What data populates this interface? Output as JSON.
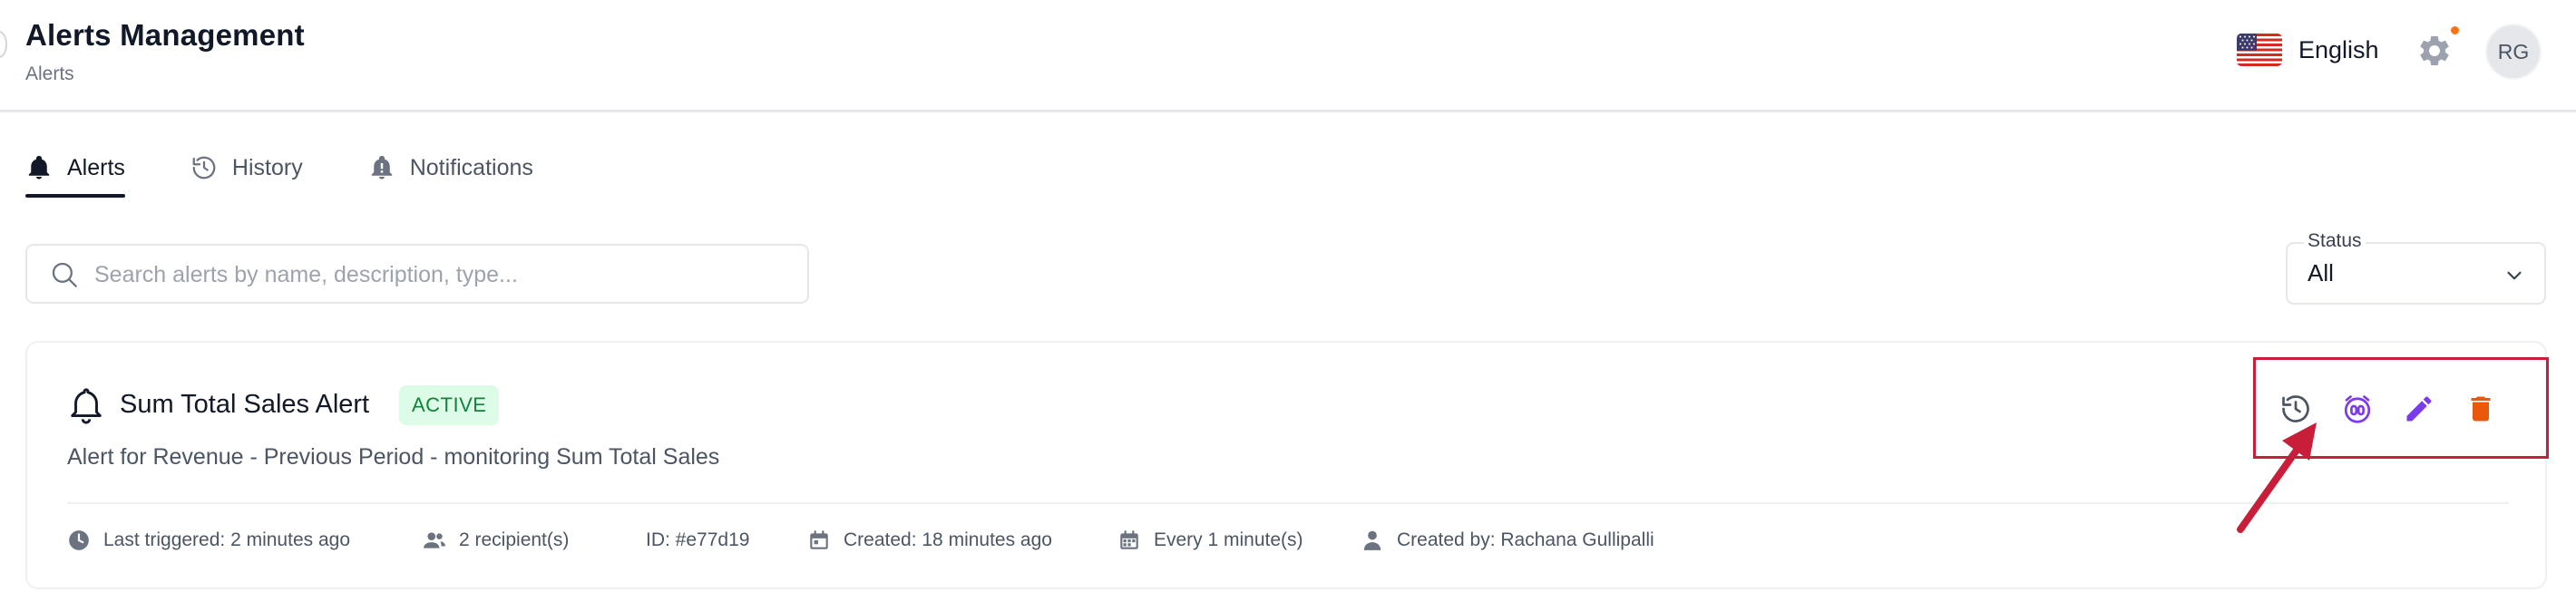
{
  "header": {
    "title": "Alerts Management",
    "breadcrumb": "Alerts",
    "language": "English",
    "avatar_initials": "RG",
    "icons": [
      "us-flag-icon",
      "gear-icon",
      "notification-dot"
    ]
  },
  "tabs": [
    {
      "label": "Alerts",
      "icon": "bell-icon",
      "active": true
    },
    {
      "label": "History",
      "icon": "history-icon",
      "active": false
    },
    {
      "label": "Notifications",
      "icon": "bell-alert-icon",
      "active": false
    }
  ],
  "search": {
    "placeholder": "Search alerts by name, description, type...",
    "value": ""
  },
  "status_filter": {
    "label": "Status",
    "value": "All"
  },
  "alert": {
    "name": "Sum Total Sales Alert",
    "status": "ACTIVE",
    "description": "Alert for Revenue - Previous Period - monitoring Sum Total Sales",
    "last_triggered": "Last triggered: 2 minutes ago",
    "recipients": "2 recipient(s)",
    "id": "ID: #e77d19",
    "created": "Created: 18 minutes ago",
    "frequency": "Every 1 minute(s)",
    "created_by": "Created by: Rachana Gullipalli",
    "actions": [
      "history-icon",
      "timer-icon",
      "edit-icon",
      "delete-icon"
    ]
  },
  "colors": {
    "active_badge_bg": "#dcfce7",
    "active_badge_text": "#15803d",
    "timer_icon": "#7c3aed",
    "edit_icon": "#7c3aed",
    "delete_icon": "#ea580c",
    "annotation": "#c81e3a"
  }
}
